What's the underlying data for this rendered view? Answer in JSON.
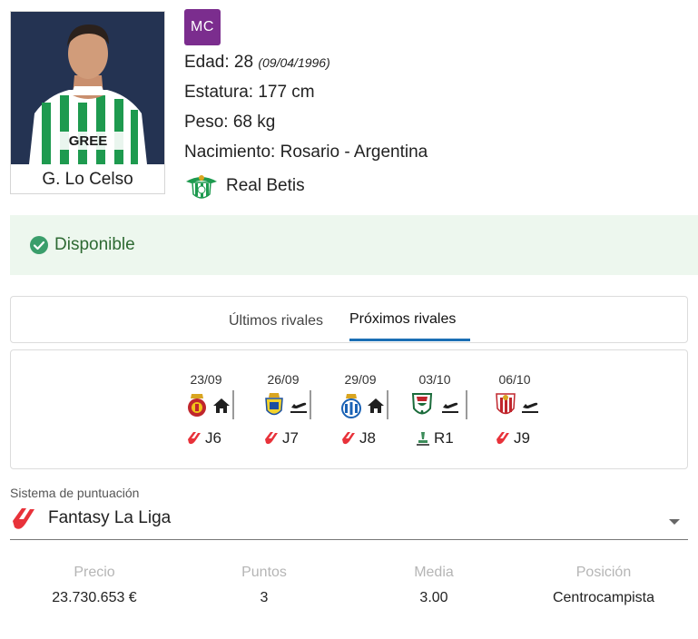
{
  "player": {
    "name": "G. Lo Celso",
    "position_badge": "MC",
    "age_line": "Edad: 28",
    "dob": "(09/04/1996)",
    "height_line": "Estatura: 177 cm",
    "weight_line": "Peso: 68 kg",
    "birth_line": "Nacimiento: Rosario - Argentina",
    "team": "Real Betis",
    "jersey_text": "GREE"
  },
  "status": {
    "label": "Disponible",
    "color": "#2e6a33",
    "background": "#edf7ee"
  },
  "tabs": {
    "last": "Últimos rivales",
    "next": "Próximos rivales",
    "active": "next",
    "accent": "#1b6fb5"
  },
  "fixtures": [
    {
      "date": "23/09",
      "crest": "mallorca-crest",
      "venue": "home-icon",
      "competition": "laliga-icon",
      "round": "J6"
    },
    {
      "date": "26/09",
      "crest": "las-palmas-crest",
      "venue": "plane-icon",
      "competition": "laliga-icon",
      "round": "J7"
    },
    {
      "date": "29/09",
      "crest": "espanyol-crest",
      "venue": "home-icon",
      "competition": "laliga-icon",
      "round": "J8"
    },
    {
      "date": "03/10",
      "crest": "legia-crest",
      "venue": "plane-icon",
      "competition": "conference-league-icon",
      "round": "R1"
    },
    {
      "date": "06/10",
      "crest": "sevilla-crest",
      "venue": "plane-icon",
      "competition": "laliga-icon",
      "round": "J9"
    }
  ],
  "scoring": {
    "label": "Sistema de puntuación",
    "value": "Fantasy La Liga"
  },
  "stats": [
    {
      "label": "Precio",
      "value": "23.730.653 €"
    },
    {
      "label": "Puntos",
      "value": "3"
    },
    {
      "label": "Media",
      "value": "3.00"
    },
    {
      "label": "Posición",
      "value": "Centrocampista"
    }
  ],
  "colors": {
    "badge": "#7b2d8e",
    "laliga_red": "#e8323a",
    "betis_green": "#1e9a4f"
  }
}
